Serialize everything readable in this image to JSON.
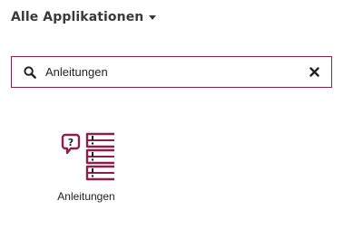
{
  "header": {
    "title": "Alle Applikationen",
    "dropdown_icon": "caret-down-icon"
  },
  "search": {
    "value": "Anleitungen",
    "search_icon": "search-icon",
    "clear_icon": "close-icon"
  },
  "apps": [
    {
      "label": "Anleitungen",
      "icon": "guides-icon"
    }
  ],
  "colors": {
    "accent": "#8d1f4b",
    "text": "#333333",
    "icon_dark": "#222222"
  }
}
